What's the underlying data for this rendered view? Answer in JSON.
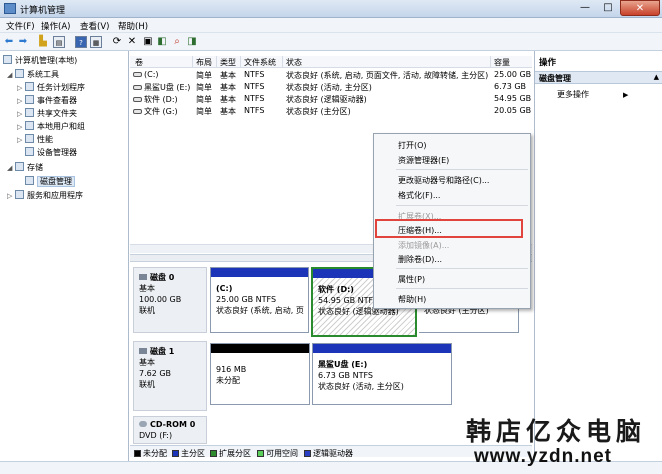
{
  "window": {
    "title": "计算机管理",
    "min": "—",
    "max": "□",
    "close": "✕"
  },
  "menu": [
    "文件(F)",
    "操作(A)",
    "查看(V)",
    "帮助(H)"
  ],
  "toolbar_icons": [
    "back-arrow",
    "forward-arrow",
    "up-folder",
    "console-tree",
    "help",
    "help-topic",
    "refresh",
    "delete",
    "properties",
    "export",
    "search",
    "disk-icon"
  ],
  "tree": {
    "root": "计算机管理(本地)",
    "system_tools": "系统工具",
    "task_scheduler": "任务计划程序",
    "event_viewer": "事件查看器",
    "shared_folders": "共享文件夹",
    "local_users": "本地用户和组",
    "performance": "性能",
    "device_manager": "设备管理器",
    "storage": "存储",
    "disk_management": "磁盘管理",
    "services_apps": "服务和应用程序"
  },
  "columns": [
    "卷",
    "布局",
    "类型",
    "文件系统",
    "状态",
    "容量"
  ],
  "volumes": [
    {
      "name": "(C:)",
      "layout": "简单",
      "type": "基本",
      "fs": "NTFS",
      "status": "状态良好 (系统, 启动, 页面文件, 活动, 故障转储, 主分区)",
      "capacity": "25.00 GB"
    },
    {
      "name": "黑鲨U盘 (E:)",
      "layout": "简单",
      "type": "基本",
      "fs": "NTFS",
      "status": "状态良好 (活动, 主分区)",
      "capacity": "6.73 GB"
    },
    {
      "name": "软件 (D:)",
      "layout": "简单",
      "type": "基本",
      "fs": "NTFS",
      "status": "状态良好 (逻辑驱动器)",
      "capacity": "54.95 GB"
    },
    {
      "name": "文件 (G:)",
      "layout": "简单",
      "type": "基本",
      "fs": "NTFS",
      "status": "状态良好 (主分区)",
      "capacity": "20.05 GB"
    }
  ],
  "disk0": {
    "name": "磁盘 0",
    "type": "基本",
    "size": "100.00 GB",
    "state": "联机",
    "c": {
      "name": "(C:)",
      "size": "25.00 GB NTFS",
      "status": "状态良好 (系统, 启动, 页"
    },
    "d": {
      "name": "软件 (D:)",
      "size": "54.95 GB NTFS",
      "status": "状态良好 (逻辑驱动器)"
    },
    "g": {
      "status": "状态良好 (主分区)"
    }
  },
  "disk1": {
    "name": "磁盘 1",
    "type": "基本",
    "size": "7.62 GB",
    "state": "联机",
    "unalloc": {
      "size": "916 MB",
      "label": "未分配"
    },
    "e": {
      "name": "黑鲨U盘 (E:)",
      "size": "6.73 GB NTFS",
      "status": "状态良好 (活动, 主分区)"
    }
  },
  "cdrom": {
    "name": "CD-ROM 0",
    "type": "DVD (F:)"
  },
  "legend": [
    {
      "label": "未分配",
      "color": "#000000"
    },
    {
      "label": "主分区",
      "color": "#1c34b8"
    },
    {
      "label": "扩展分区",
      "color": "#2e8b2e"
    },
    {
      "label": "可用空间",
      "color": "#5ad05a"
    },
    {
      "label": "逻辑驱动器",
      "color": "#2b3fc4"
    }
  ],
  "actions": {
    "header": "操作",
    "section": "磁盘管理",
    "more": "更多操作",
    "section_arrow": "▲",
    "more_arrow": "▶"
  },
  "context_menu": {
    "open": "打开(O)",
    "explorer": "资源管理器(E)",
    "change_letter": "更改驱动器号和路径(C)...",
    "format": "格式化(F)...",
    "extend": "扩展卷(X)...",
    "shrink": "压缩卷(H)...",
    "add_mirror": "添加镜像(A)...",
    "delete": "删除卷(D)...",
    "properties": "属性(P)",
    "help": "帮助(H)"
  },
  "watermark": {
    "line1": "韩店亿众电脑",
    "line2": "www.yzdn.net"
  }
}
